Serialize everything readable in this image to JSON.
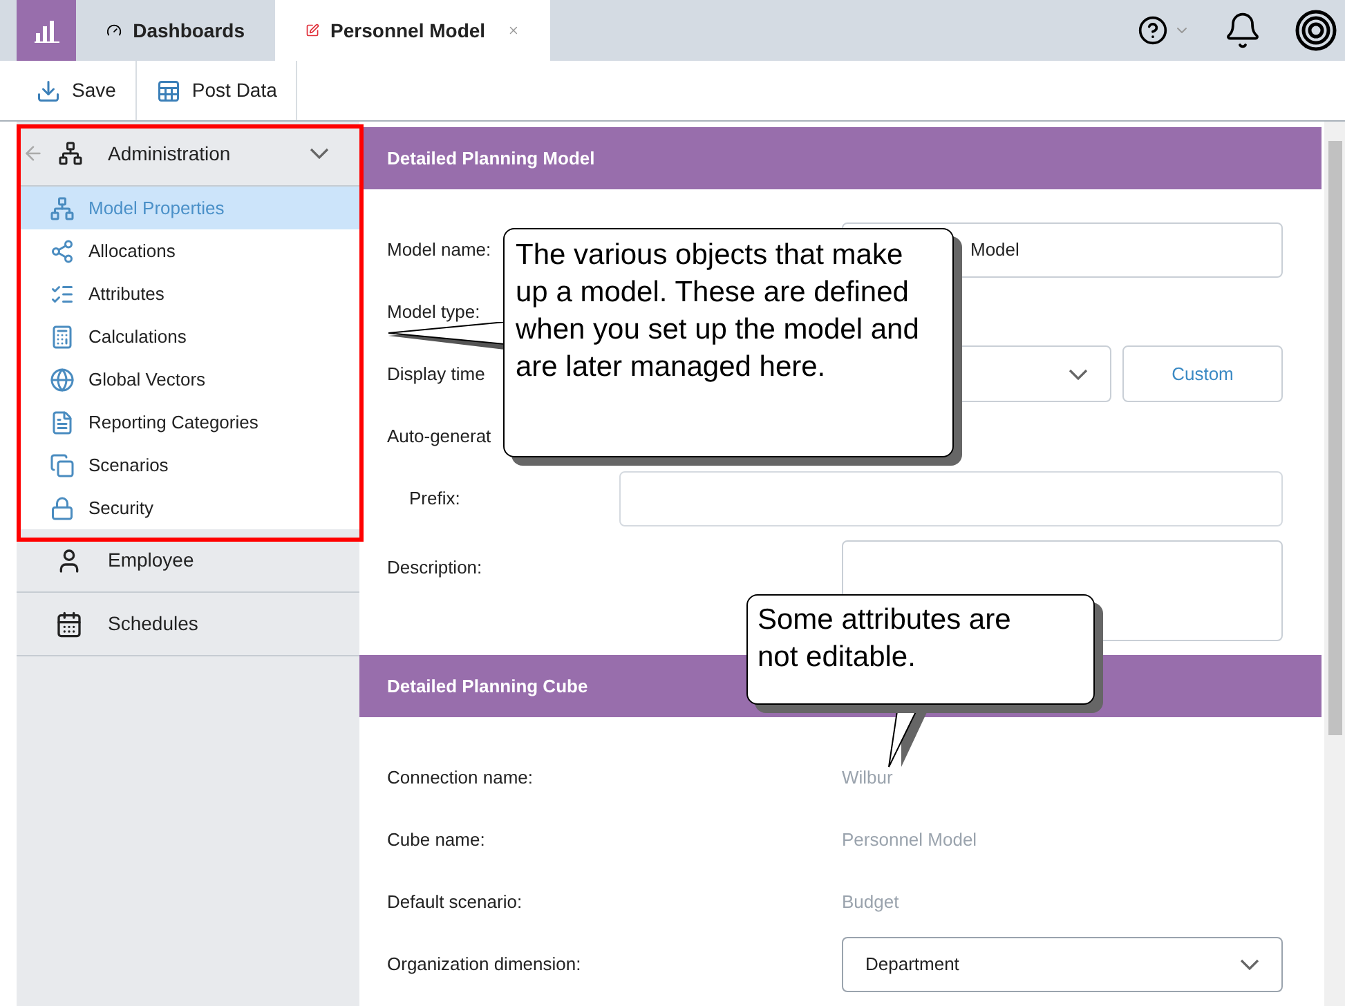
{
  "tabs": [
    {
      "label": "Dashboards",
      "kind": "dashboard",
      "selected": false,
      "closable": false
    },
    {
      "label": "Personnel Model",
      "kind": "model",
      "selected": true,
      "closable": true
    }
  ],
  "toolbar": [
    {
      "label": "Save",
      "kind": "save"
    },
    {
      "label": "Post Data",
      "kind": "post"
    }
  ],
  "sidebar": {
    "section": {
      "label": "Administration",
      "expanded": true,
      "highlighted": true,
      "children": [
        {
          "label": "Model Properties",
          "kind": "properties",
          "selected": true
        },
        {
          "label": "Allocations",
          "kind": "allocations",
          "selected": false
        },
        {
          "label": "Attributes",
          "kind": "attributes",
          "selected": false
        },
        {
          "label": "Calculations",
          "kind": "calculations",
          "selected": false
        },
        {
          "label": "Global Vectors",
          "kind": "globe",
          "selected": false
        },
        {
          "label": "Reporting Categories",
          "kind": "report",
          "selected": false
        },
        {
          "label": "Scenarios",
          "kind": "scenarios",
          "selected": false
        },
        {
          "label": "Security",
          "kind": "security",
          "selected": false
        }
      ]
    },
    "items": [
      {
        "label": "Employee",
        "kind": "employee"
      },
      {
        "label": "Schedules",
        "kind": "schedules"
      }
    ]
  },
  "sections": [
    {
      "title": "Detailed Planning Model",
      "rows": [
        {
          "label": "Model name:",
          "kind": "input",
          "value": "Model"
        },
        {
          "label": "Model type:",
          "kind": "empty"
        },
        {
          "label": "Display time",
          "kind": "select_button",
          "button": "Custom"
        },
        {
          "label": "Auto-generat",
          "kind": "empty"
        },
        {
          "label": "Prefix:",
          "kind": "indented_input"
        },
        {
          "label": "Description:",
          "kind": "textarea"
        }
      ]
    },
    {
      "title": "Detailed Planning Cube",
      "rows": [
        {
          "label": "Connection name:",
          "kind": "readonly",
          "value": "Wilbur"
        },
        {
          "label": "Cube name:",
          "kind": "readonly",
          "value": "Personnel Model"
        },
        {
          "label": "Default scenario:",
          "kind": "readonly",
          "value": "Budget"
        },
        {
          "label": "Organization dimension:",
          "kind": "select",
          "value": "Department"
        }
      ]
    }
  ],
  "callouts": [
    {
      "text": "The various objects that make up a model. These are defined when you set up the model and are later managed here.",
      "kind": "left"
    },
    {
      "text": "Some attributes are not editable.",
      "kind": "down"
    }
  ]
}
